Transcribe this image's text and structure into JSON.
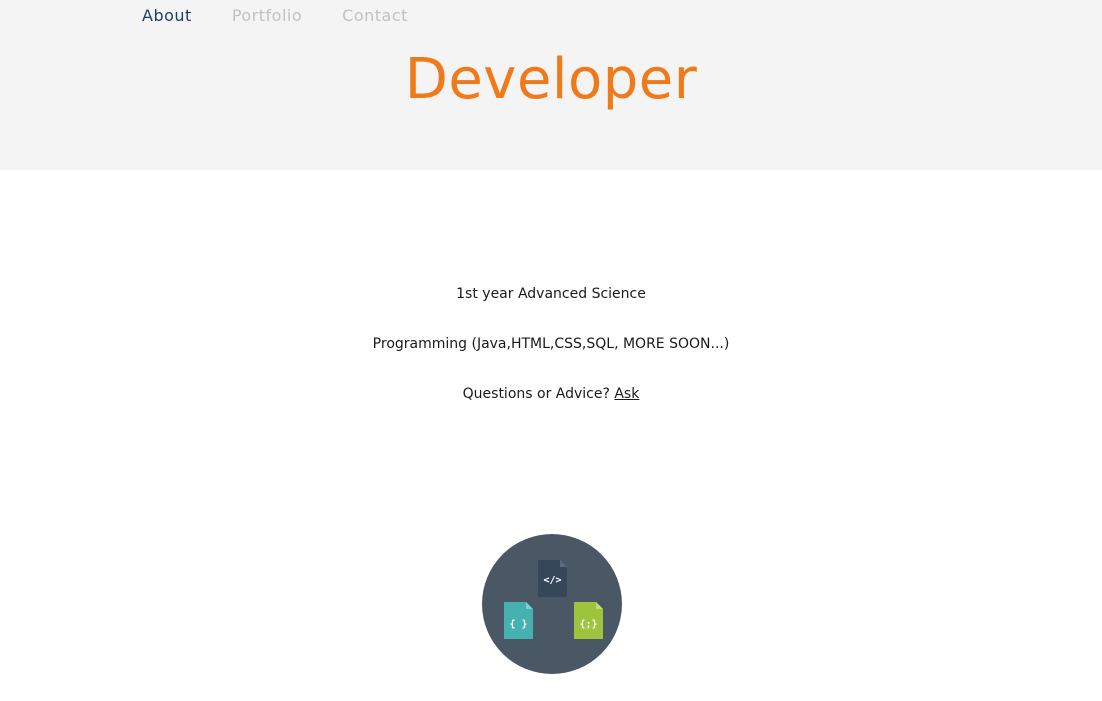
{
  "nav": {
    "items": [
      {
        "label": "About",
        "active": true
      },
      {
        "label": "Portfolio",
        "active": false
      },
      {
        "label": "Contact",
        "active": false
      }
    ]
  },
  "header": {
    "title": "Developer"
  },
  "info": {
    "line1": "1st year Advanced Science",
    "line2": "Programming (Java,HTML,CSS,SQL, MORE SOON...)",
    "line3_prefix": "Questions or Advice? ",
    "line3_link": "Ask"
  },
  "logo": {
    "files": [
      {
        "glyph": "</>",
        "color": "#37475a",
        "icon": "html-file-icon"
      },
      {
        "glyph": "{ }",
        "color": "#45b2b0",
        "icon": "css-file-icon"
      },
      {
        "glyph": "{;}",
        "color": "#9cc43d",
        "icon": "js-file-icon"
      }
    ],
    "circle_color": "#4a5866"
  },
  "colors": {
    "accent": "#f07a1a",
    "nav_active": "#1c3e6e",
    "nav_inactive": "#c2c2c2",
    "header_bg": "#f4f4f4"
  }
}
